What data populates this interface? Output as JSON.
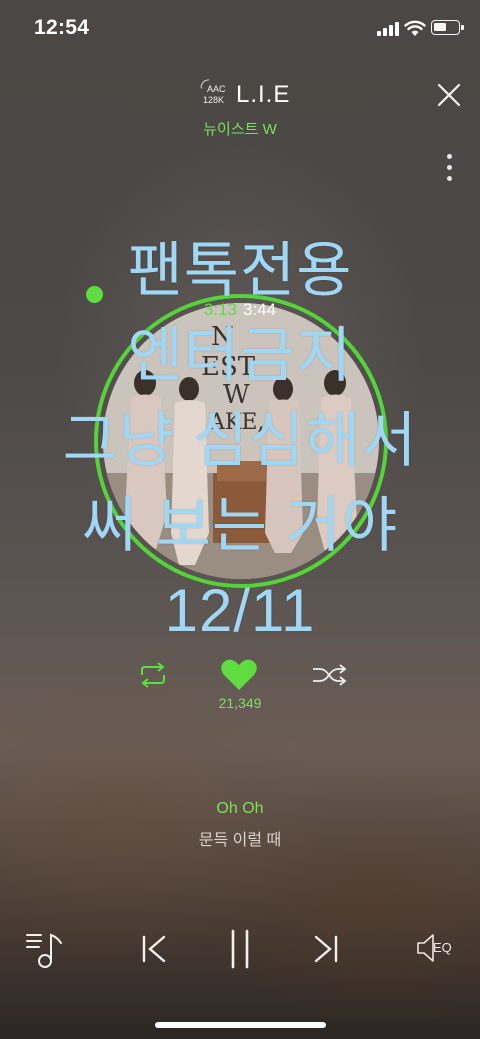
{
  "status_bar": {
    "time": "12:54"
  },
  "header": {
    "codec": "AAC",
    "bitrate": "128K",
    "song_title": "L.I.E",
    "artist": "뉴이스트 W"
  },
  "player": {
    "elapsed": "3:13",
    "duration": "3:44",
    "progress_fraction": 0.86,
    "like_count": "21,349"
  },
  "overlay_text": [
    "팬톡전용",
    "엔터금지",
    "그냥 심심해서",
    "써 보는 거야",
    "12/11"
  ],
  "lyrics": {
    "current": "Oh Oh",
    "next": "문득 이럴 때"
  },
  "controls": {
    "eq_label": "EQ"
  },
  "colors": {
    "accent_green": "#55d33a",
    "overlay_blue": "#9fd7f5"
  }
}
